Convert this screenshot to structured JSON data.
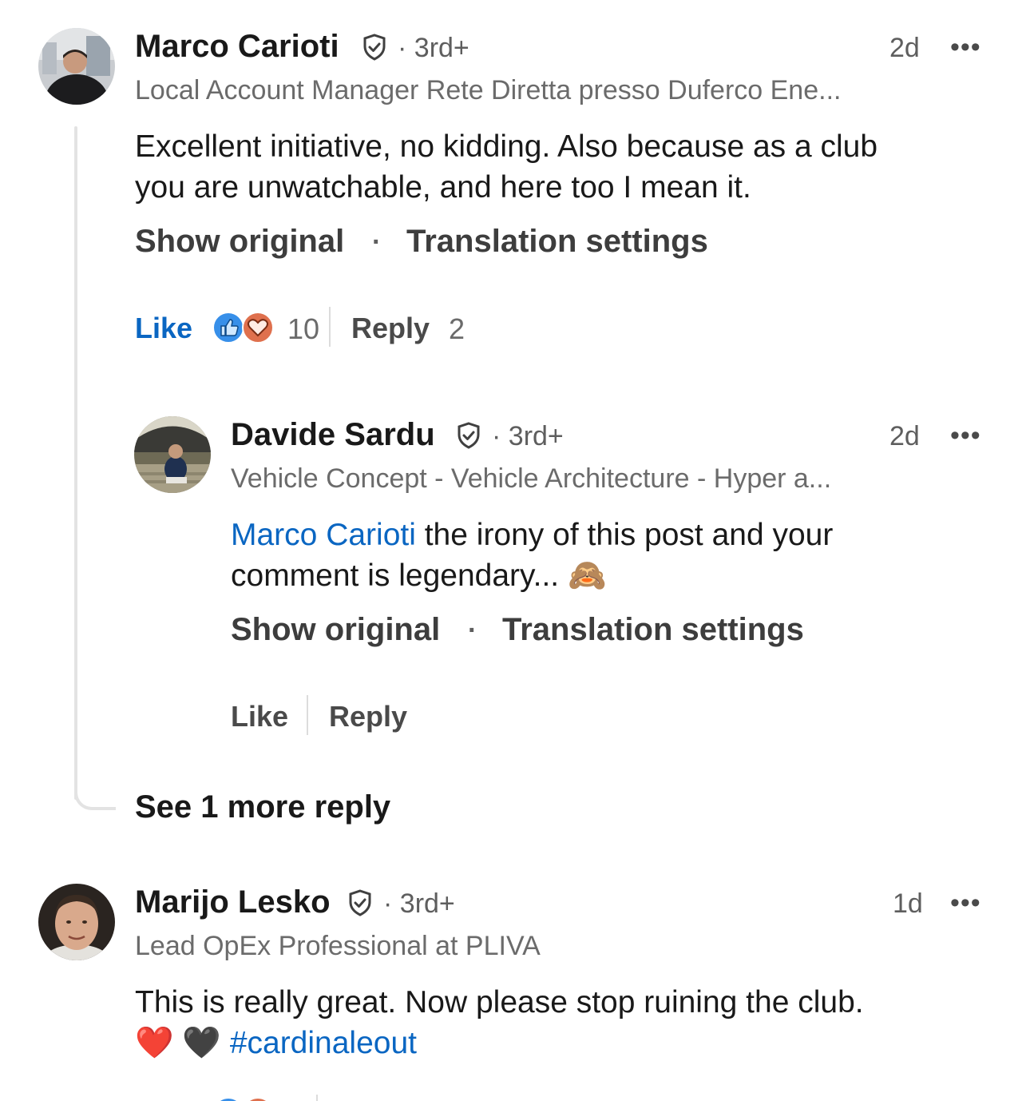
{
  "comments": [
    {
      "author": "Marco Carioti",
      "degree": "3rd+",
      "time": "2d",
      "headline": "Local Account Manager Rete Diretta presso Duferco Ene...",
      "text_line1": "Excellent initiative, no kidding. Also because as a club",
      "text_line2": "you are unwatchable, and here too I mean it.",
      "show_original": "Show original",
      "translation_settings": "Translation settings",
      "like_label": "Like",
      "reaction_count": "10",
      "reply_label": "Reply",
      "reply_count": "2",
      "avatar_icon": "avatar-photo-marco"
    },
    {
      "author": "Davide Sardu",
      "degree": "3rd+",
      "time": "2d",
      "headline": "Vehicle Concept - Vehicle Architecture - Hyper a...",
      "mention": "Marco Carioti",
      "text_line1_rest": " the irony of this post and your",
      "text_line2": "comment is legendary...",
      "emoji": "🙈",
      "show_original": "Show original",
      "translation_settings": "Translation settings",
      "like_label": "Like",
      "reply_label": "Reply",
      "avatar_icon": "avatar-photo-davide"
    },
    {
      "author": "Marijo Lesko",
      "degree": "3rd+",
      "time": "1d",
      "headline": "Lead OpEx Professional at PLIVA",
      "text_line1": "This is really great. Now please stop ruining the club.",
      "emoji1": "❤️",
      "emoji2": "🖤",
      "hashtag": "#cardinaleout",
      "avatar_icon": "avatar-photo-marijo"
    }
  ],
  "see_more_replies": "See 1 more reply",
  "dot_separator": "·",
  "more_icon": "•••",
  "colors": {
    "link_blue": "#0a66c2",
    "like_reaction": "#378fe9",
    "love_reaction": "#df704d",
    "text_primary": "#191919",
    "text_secondary": "#6b6b6b"
  }
}
